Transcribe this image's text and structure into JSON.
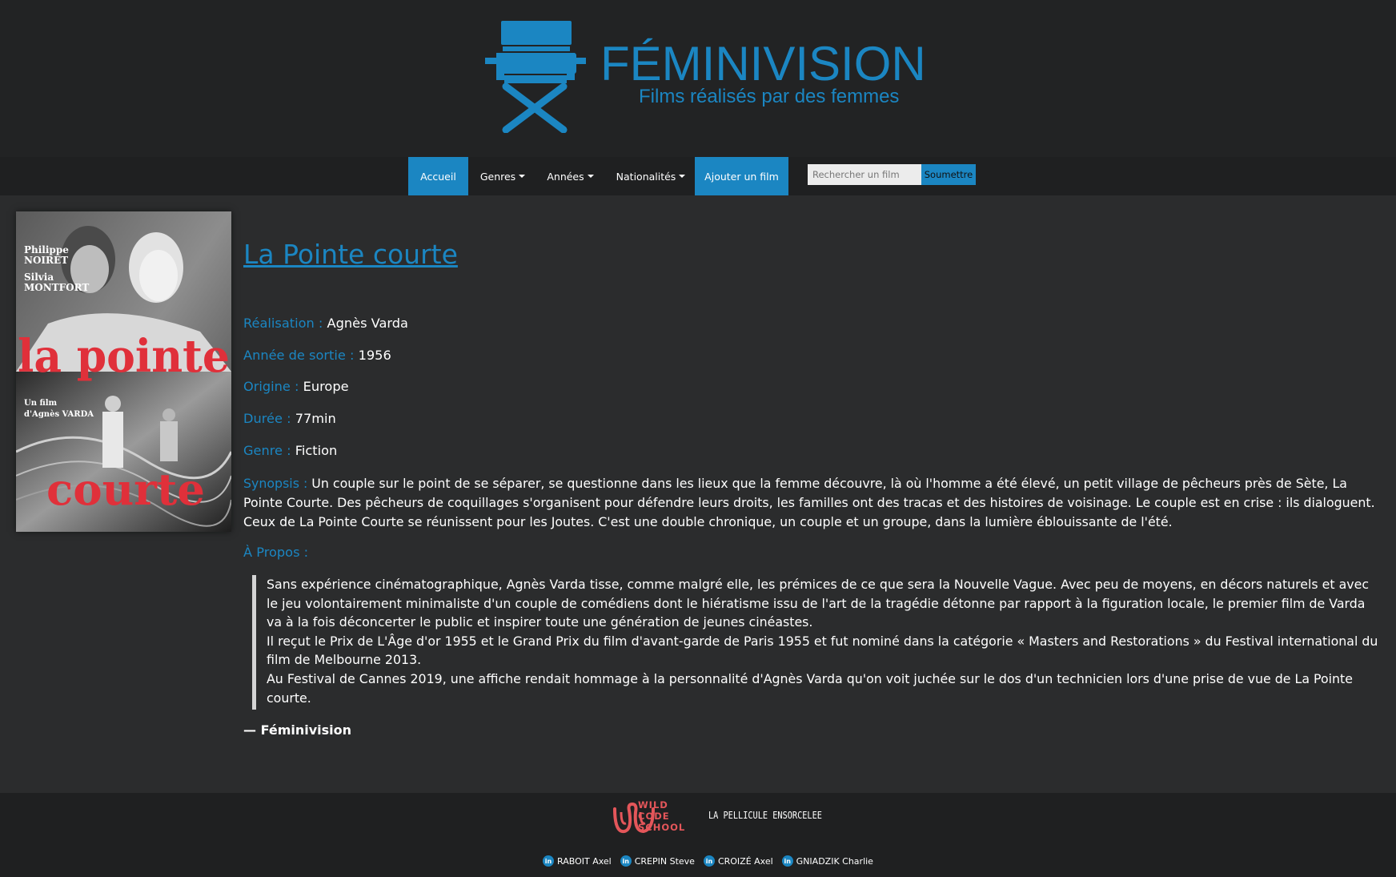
{
  "brand": {
    "name": "FÉMINIVISION",
    "tagline": "Films réalisés par des femmes",
    "color": "#1b86c2"
  },
  "navbar": {
    "items": [
      {
        "label": "Accueil",
        "active": true
      },
      {
        "label": "Genres",
        "dropdown": true
      },
      {
        "label": "Années",
        "dropdown": true
      },
      {
        "label": "Nationalités",
        "dropdown": true
      },
      {
        "label": "Ajouter un film",
        "active": true
      }
    ],
    "search": {
      "placeholder": "Rechercher un film",
      "button_label": "Soumettre"
    }
  },
  "poster": {
    "actors": [
      "Philippe",
      "NOIRET",
      "Silvia",
      "MONTFORT"
    ],
    "title_top": "la pointe",
    "title_bottom": "courte",
    "credit_line1": "Un film",
    "credit_line2": "d'Agnès VARDA"
  },
  "film": {
    "title": "La Pointe courte",
    "fields": [
      {
        "label": "Réalisation : ",
        "value": " Agnès Varda"
      },
      {
        "label": "Année de sortie : ",
        "value": "1956"
      },
      {
        "label": "Origine : ",
        "value": "Europe"
      },
      {
        "label": "Durée : ",
        "value": "77min"
      },
      {
        "label": "Genre : ",
        "value": " Fiction"
      }
    ],
    "synopsis_label": "Synopsis : ",
    "synopsis": "Un couple sur le point de se séparer, se questionne dans les lieux que la femme découvre, là où l'homme a été élevé, un petit village de pêcheurs près de Sète, La Pointe Courte. Des pêcheurs de coquillages s'organisent pour défendre leurs droits, les familles ont des tracas et des histoires de voisinage. Le couple est en crise : ils dialoguent. Ceux de La Pointe Courte se réunissent pour les Joutes. C'est une double chronique, un couple et un groupe, dans la lumière éblouissante de l'été.",
    "apropos_label": "À Propos :",
    "apropos": [
      "Sans expérience cinématographique, Agnès Varda tisse, comme malgré elle, les prémices de ce que sera la Nouvelle Vague. Avec peu de moyens, en décors naturels et avec le jeu volontairement minimaliste d'un couple de comédiens dont le hiératisme issu de l'art de la tragédie détonne par rapport à la figuration locale, le premier film de Varda va à la fois déconcerter le public et inspirer toute une génération de jeunes cinéastes.",
      "Il reçut le Prix de L'Âge d'or 1955 et le Grand Prix du film d'avant-garde de Paris 1955 et fut nominé dans la catégorie « Masters and Restorations » du Festival international du film de Melbourne 2013.",
      "Au Festival de Cannes 2019, une affiche rendait hommage à la personnalité d'Agnès Varda qu'on voit juchée sur le dos d'un technicien lors d'une prise de vue de La Pointe courte."
    ],
    "source": "— Féminivision"
  },
  "footer": {
    "wcs": [
      "WILD",
      "CODE",
      "SCHOOL"
    ],
    "pellicule": "LA PELLICULE ENSORCELEE",
    "credits": [
      "RABOIT Axel",
      "CREPIN Steve",
      "CROIZÉ Axel",
      "GNIADZIK Charlie"
    ],
    "linkedin_glyph": "in"
  }
}
